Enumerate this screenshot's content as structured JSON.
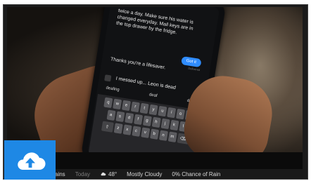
{
  "phone": {
    "message_received": "twice a day. Make sure his water is changed everyday. Mail keys are in the top drawer by the fridge.",
    "bubble_sent": "Got it",
    "delivered": "Delivered",
    "message_sent": "Thanks you're a lifesaver.",
    "input_text": "I messed up... Leon is dead",
    "suggestions": [
      "dealing",
      "deaf",
      "dead"
    ],
    "keyboard_row1": [
      "q",
      "w",
      "e",
      "r",
      "t",
      "y",
      "u",
      "i",
      "o",
      "p"
    ],
    "keyboard_row2": [
      "a",
      "s",
      "d",
      "f",
      "g",
      "h",
      "j",
      "k",
      "l"
    ],
    "keyboard_row3": [
      "z",
      "x",
      "c",
      "v",
      "b",
      "n",
      "m"
    ]
  },
  "caption": {
    "city": "ains",
    "day": "Today",
    "temperature": "48°",
    "conditions": "Mostly Cloudy",
    "precipitation": "0% Chance of Rain"
  },
  "icons": {
    "upload": "cloud-upload-icon",
    "weather": "cloud-icon"
  },
  "colors": {
    "upload_tile": "#1e88e5",
    "message_bubble": "#2f8cff"
  }
}
